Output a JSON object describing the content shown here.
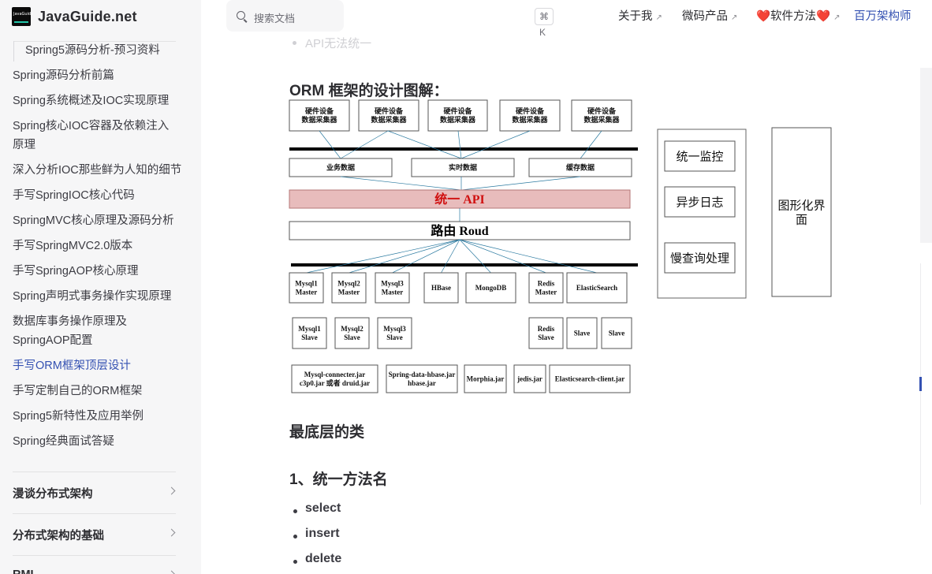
{
  "brand": {
    "name": "JavaGuide.net",
    "logo_text": "JavaGuide"
  },
  "sidebar": {
    "items": [
      {
        "label": "Spring5源码分析-预习资料",
        "sub": true
      },
      {
        "label": "Spring源码分析前篇"
      },
      {
        "label": "Spring系统概述及IOC实现原理"
      },
      {
        "label": "Spring核心IOC容器及依赖注入"
      },
      {
        "label": "原理"
      },
      {
        "label": "深入分析IOC那些鲜为人知的细节"
      },
      {
        "label": "手写SpringIOC核心代码"
      },
      {
        "label": "SpringMVC核心原理及源码分析"
      },
      {
        "label": "手写SpringMVC2.0版本"
      },
      {
        "label": "手写SpringAOP核心原理"
      },
      {
        "label": "Spring声明式事务操作实现原理"
      },
      {
        "label": "数据库事务操作原理及"
      },
      {
        "label": "SpringAOP配置"
      },
      {
        "label": "手写ORM框架顶层设计",
        "active": true
      },
      {
        "label": "手写定制自己的ORM框架"
      },
      {
        "label": "Spring5新特性及应用举例"
      },
      {
        "label": "Spring经典面试答疑"
      }
    ],
    "sections": [
      "漫谈分布式架构",
      "分布式架构的基础",
      "RMI"
    ]
  },
  "header": {
    "search_placeholder": "搜索文档",
    "search_shortcut": "⌘ K",
    "nav": [
      {
        "label": "关于我",
        "external": true
      },
      {
        "label": "微码产品",
        "external": true
      },
      {
        "label": "❤️软件方法❤️",
        "external": true
      },
      {
        "label": "百万架构师",
        "external": false
      }
    ]
  },
  "content": {
    "faded_item": "API无法统一",
    "diagram_heading": "ORM 框架的设计图解：",
    "heading_bottom": "最底层的类",
    "heading_method": "1、统一方法名",
    "list": [
      "select",
      "insert",
      "delete"
    ]
  },
  "diagram": {
    "collectors": [
      "硬件设备\n数据采集器",
      "硬件设备\n数据采集器",
      "硬件设备\n数据采集器",
      "硬件设备\n数据采集器",
      "硬件设备\n数据采集器"
    ],
    "data": [
      "业务数据",
      "实时数据",
      "缓存数据"
    ],
    "api": "统一 API",
    "route": "路由 Roud",
    "masters": [
      "Mysql1\nMaster",
      "Mysql2\nMaster",
      "Mysql3\nMaster",
      "HBase",
      "MongoDB",
      "Redis\nMaster",
      "ElasticSearch"
    ],
    "slaves": [
      "Mysql1\nSlave",
      "Mysql2\nSlave",
      "Mysql3\nSlave",
      "Redis\nSlave",
      "Slave",
      "Slave"
    ],
    "jars": [
      "Mysql-connecter.jar\nc3p0.jar 或者 druid.jar",
      "Spring-data-hbase.jar\nhbase.jar",
      "Morphia.jar",
      "jedis.jar",
      "Elasticsearch-client.jar"
    ],
    "side_panel": [
      "统一监控",
      "异步日志",
      "慢查询处理"
    ],
    "gui": "图形化界\n面"
  }
}
